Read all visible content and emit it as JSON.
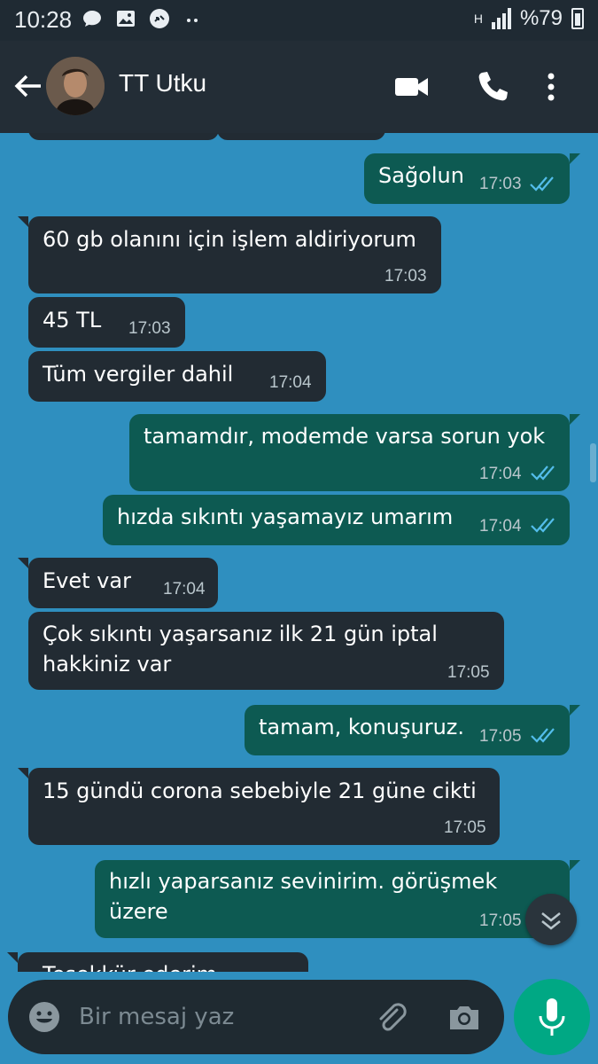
{
  "status_bar": {
    "time": "10:28",
    "battery": "%79",
    "network": "H"
  },
  "header": {
    "contact_name": "TT Utku"
  },
  "messages": [
    {
      "text1": "Sağolun",
      "time": "17:03"
    },
    {
      "text1": "60 gb olanını için işlem aldiriyorum",
      "time": "17:03"
    },
    {
      "text1": "45 TL",
      "time": "17:03"
    },
    {
      "text1": "Tüm vergiler dahil",
      "time": "17:04"
    },
    {
      "text1": "tamamdır, modemde varsa sorun yok",
      "time": "17:04"
    },
    {
      "text1": "hızda sıkıntı yaşamayız umarım",
      "time": "17:04"
    },
    {
      "text1": "Evet var",
      "time": "17:04"
    },
    {
      "text1": "Çok sıkıntı yaşarsanız ilk 21  gün iptal",
      "text2": "hakkiniz var",
      "time": "17:05"
    },
    {
      "text1": "tamam, konuşuruz.",
      "time": "17:05"
    },
    {
      "text1": "15 gündü corona sebebiyle 21 güne cikti",
      "time": "17:05"
    },
    {
      "text1": "hızlı yaparsanız sevinirim. görüşmek",
      "text2": "üzere",
      "time": "17:05"
    },
    {
      "text1": "Teşekkür ederim"
    }
  ],
  "composer": {
    "placeholder": "Bir mesaj yaz"
  },
  "colors": {
    "chat_background": "#2f8fbf",
    "incoming_bubble": "#222b33",
    "outgoing_bubble": "#0d5a52",
    "read_ticks": "#53bdeb",
    "mic_button": "#00a884"
  }
}
